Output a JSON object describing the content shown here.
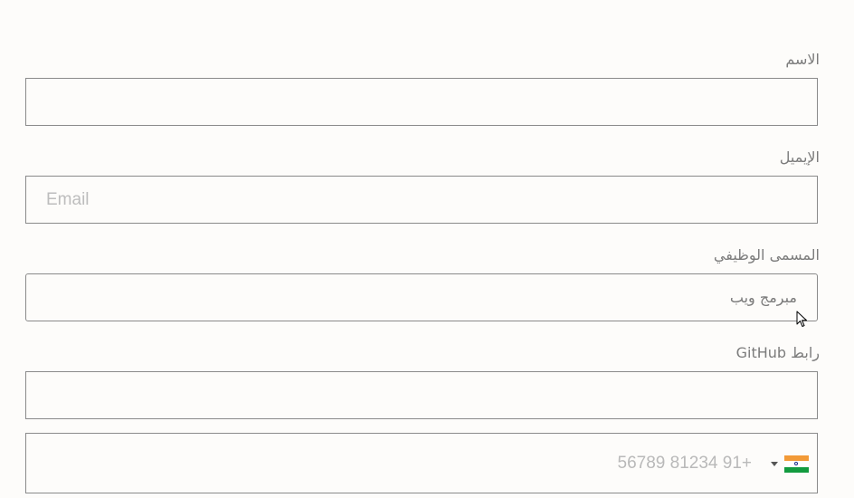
{
  "form": {
    "name": {
      "label": "الاسم",
      "value": "",
      "placeholder": ""
    },
    "email": {
      "label": "الإيميل",
      "value": "",
      "placeholder": "Email"
    },
    "job_title": {
      "label": "المسمى الوظيفي",
      "value": "مبرمج ويب",
      "placeholder": ""
    },
    "github": {
      "label": "رابط GitHub",
      "value": "",
      "placeholder": ""
    },
    "phone": {
      "country_icon": "india-flag-icon",
      "value": "",
      "placeholder": "+91 81234 56789"
    }
  },
  "colors": {
    "border": "#8a8a8a",
    "label": "#7c7c7c",
    "placeholder": "#bdbdbd",
    "background": "#fdfcfa"
  }
}
